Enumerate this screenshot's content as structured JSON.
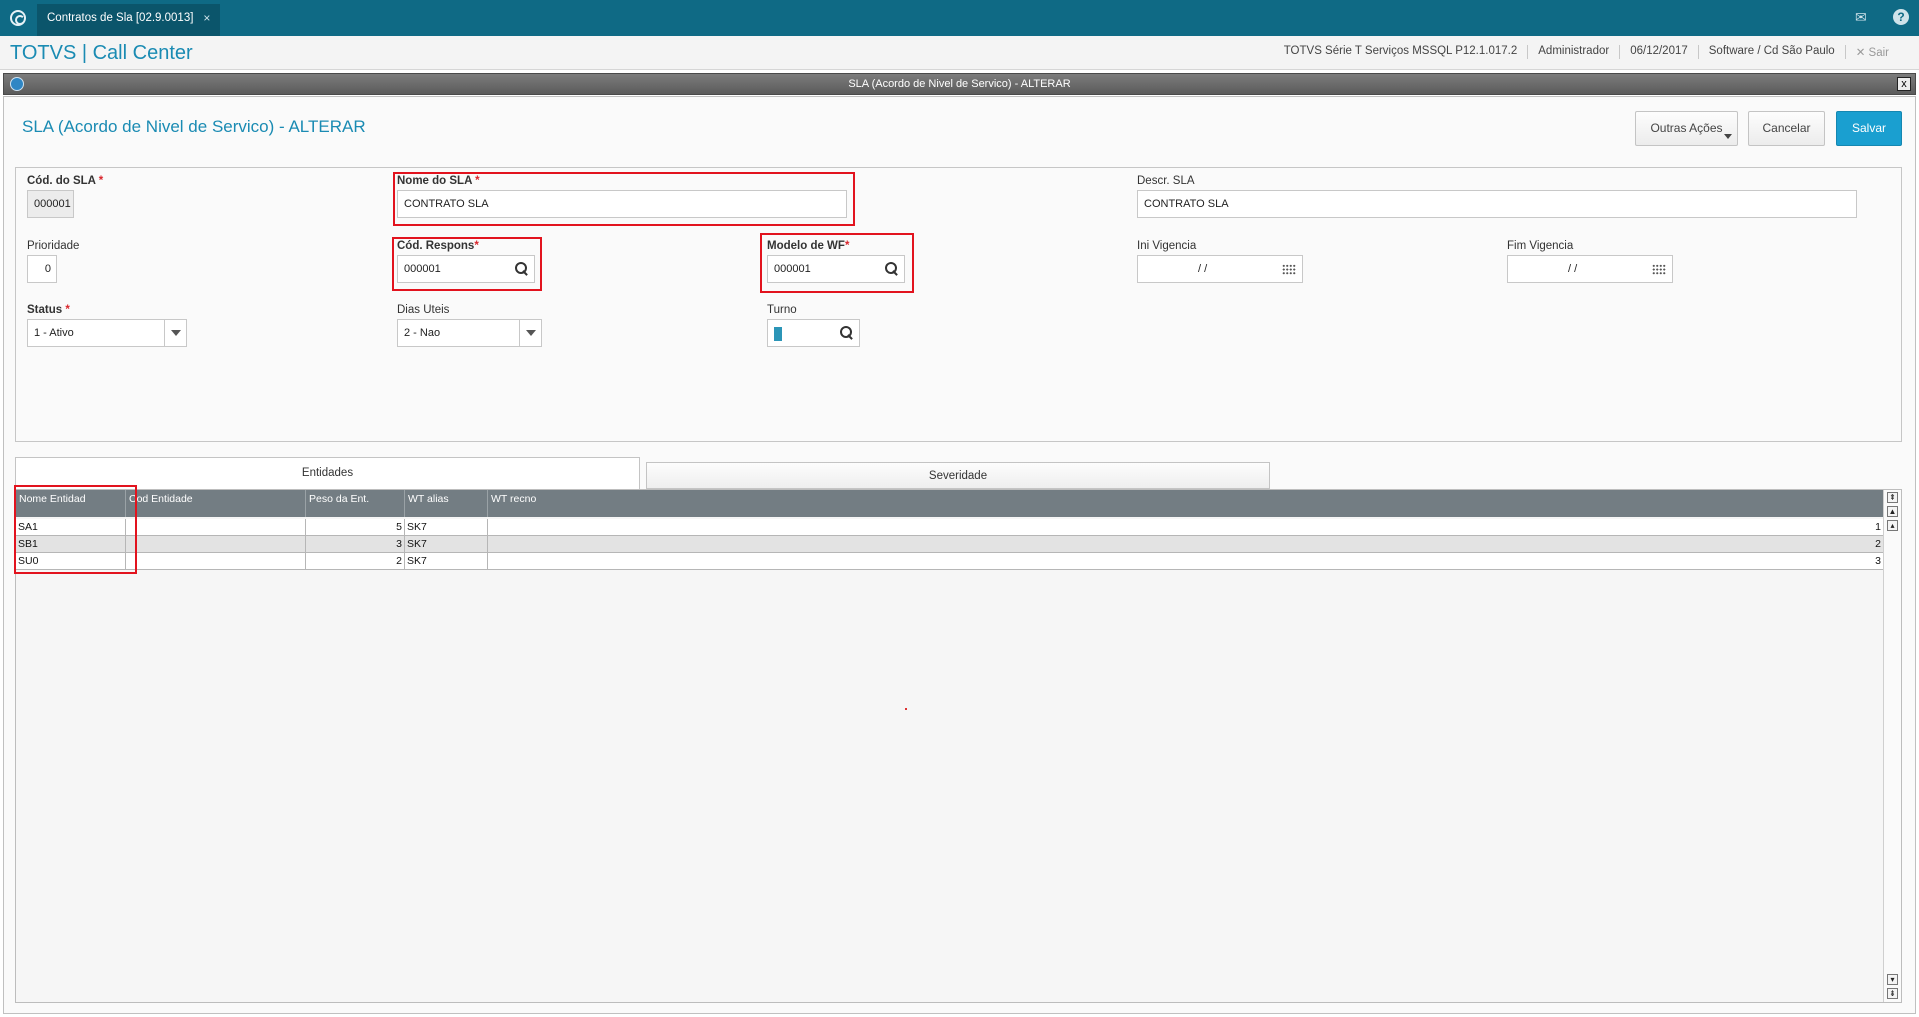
{
  "tab": {
    "label": "Contratos de Sla [02.9.0013]",
    "close": "×"
  },
  "brand": "TOTVS | Call Center",
  "header_info": {
    "system": "TOTVS Série T Serviços MSSQL P12.1.017.2",
    "user": "Administrador",
    "date": "06/12/2017",
    "company": "Software / Cd São Paulo",
    "logout": "✕  Sair"
  },
  "dialog": {
    "title": "SLA (Acordo de Nivel de Servico) - ALTERAR",
    "close": "x"
  },
  "page_title": "SLA (Acordo de Nivel de Servico) - ALTERAR",
  "actions": {
    "other": "Outras Ações",
    "cancel": "Cancelar",
    "save": "Salvar"
  },
  "form": {
    "cod_sla": {
      "label": "Cód. do SLA",
      "req": "*",
      "value": "000001"
    },
    "nome_sla": {
      "label": "Nome do SLA",
      "req": "*",
      "value": "CONTRATO SLA"
    },
    "descr_sla": {
      "label": "Descr. SLA",
      "value": "CONTRATO SLA"
    },
    "prioridade": {
      "label": "Prioridade",
      "value": "0"
    },
    "cod_respons": {
      "label": "Cód. Respons",
      "req": "*",
      "value": "000001"
    },
    "modelo_wf": {
      "label": "Modelo de WF",
      "req": "*",
      "value": "000001"
    },
    "ini_vigencia": {
      "label": "Ini Vigencia",
      "value": "/ /"
    },
    "fim_vigencia": {
      "label": "Fim Vigencia",
      "value": "/ /"
    },
    "status": {
      "label": "Status",
      "req": "*",
      "value": "1 - Ativo"
    },
    "dias_uteis": {
      "label": "Dias Uteis",
      "value": "2 - Nao"
    },
    "turno": {
      "label": "Turno",
      "value": ""
    }
  },
  "tabs": {
    "entidades": "Entidades",
    "severidade": "Severidade"
  },
  "grid": {
    "columns": [
      "Nome Entidad",
      "Cod Entidade",
      "Peso da Ent.",
      "WT alias",
      "WT recno"
    ],
    "rows": [
      {
        "nome": "SA1",
        "cod": "",
        "peso": "5",
        "alias": "SK7",
        "recno": "1"
      },
      {
        "nome": "SB1",
        "cod": "",
        "peso": "3",
        "alias": "SK7",
        "recno": "2"
      },
      {
        "nome": "SU0",
        "cod": "",
        "peso": "2",
        "alias": "SK7",
        "recno": "3"
      }
    ]
  },
  "colors": {
    "accent": "#1a8bb3",
    "topbar": "#0f6a85",
    "save": "#1a9fd0",
    "highlight": "#e2131e"
  }
}
